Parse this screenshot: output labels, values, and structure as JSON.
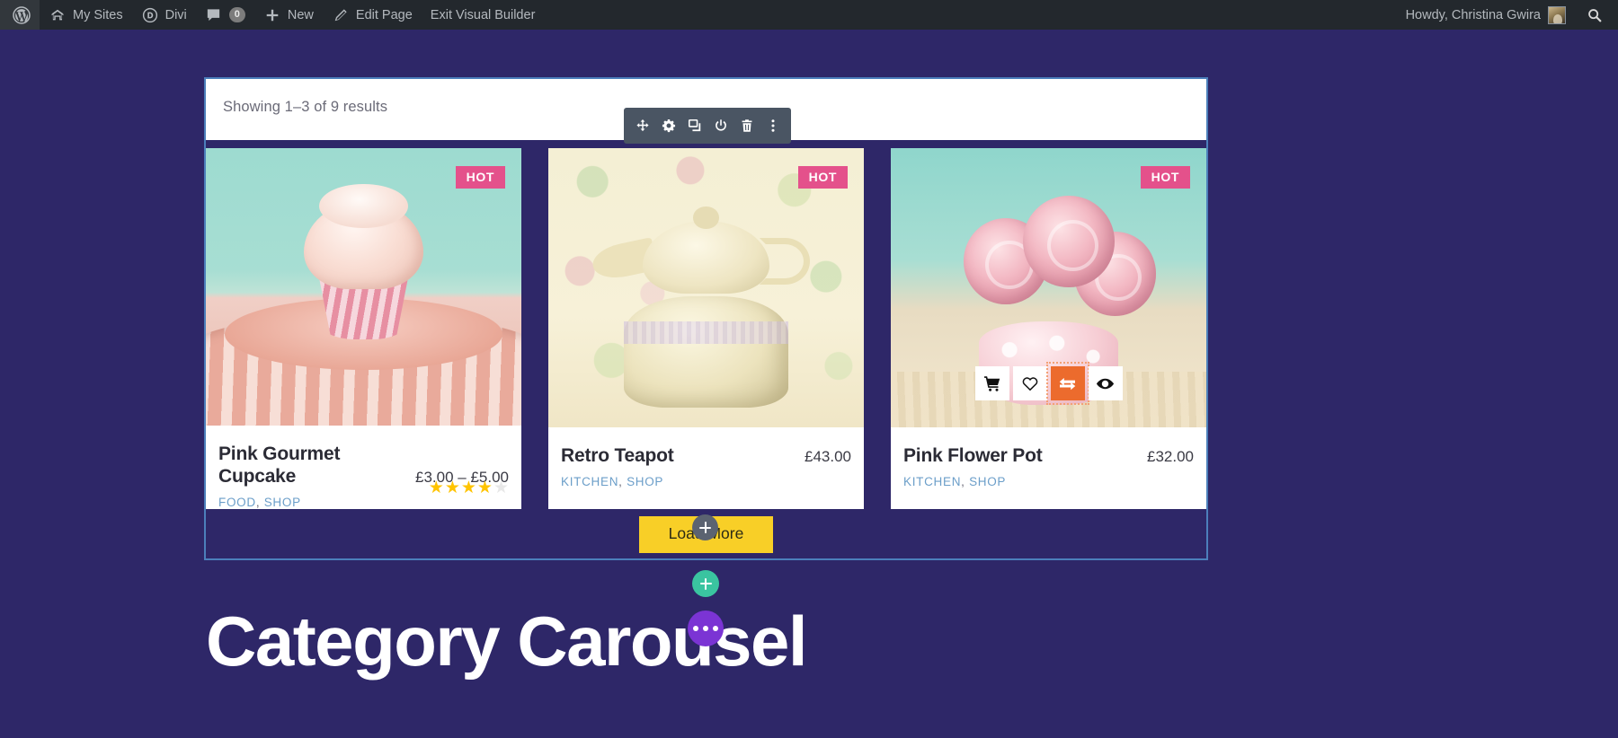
{
  "adminbar": {
    "items": [
      {
        "icon": "wordpress-logo-icon",
        "label": ""
      },
      {
        "icon": "my-sites-icon",
        "label": "My Sites"
      },
      {
        "icon": "divi-icon",
        "label": "Divi"
      },
      {
        "icon": "comments-icon",
        "label": "",
        "count": "0"
      },
      {
        "icon": "plus-icon",
        "label": "New"
      },
      {
        "icon": "pencil-icon",
        "label": "Edit Page"
      },
      {
        "icon": "",
        "label": "Exit Visual Builder"
      }
    ],
    "howdy": "Howdy, Christina Gwira",
    "avatar_name": "user-avatar",
    "search_icon": "search-icon"
  },
  "shop": {
    "result_count": "Showing 1–3 of 9 results",
    "load_more_label": "Load More"
  },
  "toolbar": {
    "buttons": [
      {
        "name": "move-module-icon",
        "title": "Move Module"
      },
      {
        "name": "gear-settings-icon",
        "title": "Module Settings"
      },
      {
        "name": "duplicate-module-icon",
        "title": "Duplicate Module"
      },
      {
        "name": "power-disable-icon",
        "title": "Disable Module"
      },
      {
        "name": "trash-delete-icon",
        "title": "Delete Module"
      },
      {
        "name": "more-options-icon",
        "title": "More Options"
      }
    ]
  },
  "products": [
    {
      "name": "Pink Gourmet Cupcake",
      "price": "£3.00 – £5.00",
      "badge": "HOT",
      "categories": [
        "FOOD",
        "SHOP"
      ],
      "rating": 4,
      "rating_max": 5,
      "image": "cupcake-on-polka-dot-plate",
      "show_actions": false
    },
    {
      "name": "Retro Teapot",
      "price": "£43.00",
      "badge": "HOT",
      "categories": [
        "KITCHEN",
        "SHOP"
      ],
      "rating": 0,
      "rating_max": 5,
      "image": "retro-teapot-on-polka-dot-background",
      "show_actions": false
    },
    {
      "name": "Pink Flower Pot",
      "price": "£32.00",
      "badge": "HOT",
      "categories": [
        "KITCHEN",
        "SHOP"
      ],
      "rating": 0,
      "rating_max": 5,
      "image": "pink-roses-in-polka-dot-pot",
      "show_actions": true,
      "actions": [
        {
          "name": "add-to-cart-icon",
          "active": false
        },
        {
          "name": "wishlist-heart-icon",
          "active": false
        },
        {
          "name": "compare-icon",
          "active": true
        },
        {
          "name": "quick-view-eye-icon",
          "active": false
        }
      ]
    }
  ],
  "fabs": [
    {
      "name": "add-module-button",
      "glyph": "plus"
    },
    {
      "name": "add-row-button",
      "glyph": "plus"
    },
    {
      "name": "section-options-button",
      "glyph": "dots"
    }
  ],
  "bottom": {
    "heading": "Category Carousel"
  },
  "colors": {
    "page_bg": "#2e2768",
    "adminbar_bg": "#23282d",
    "badge_pink": "#e4518b",
    "load_more_yellow": "#f8cf27",
    "accent_orange": "#ec6b2d",
    "teal_fab": "#3ac4a0",
    "purple_fab": "#7b34d4",
    "selection_blue": "#4c7fbb",
    "category_link": "#6b9ec9",
    "star_gold": "#ffc400"
  }
}
